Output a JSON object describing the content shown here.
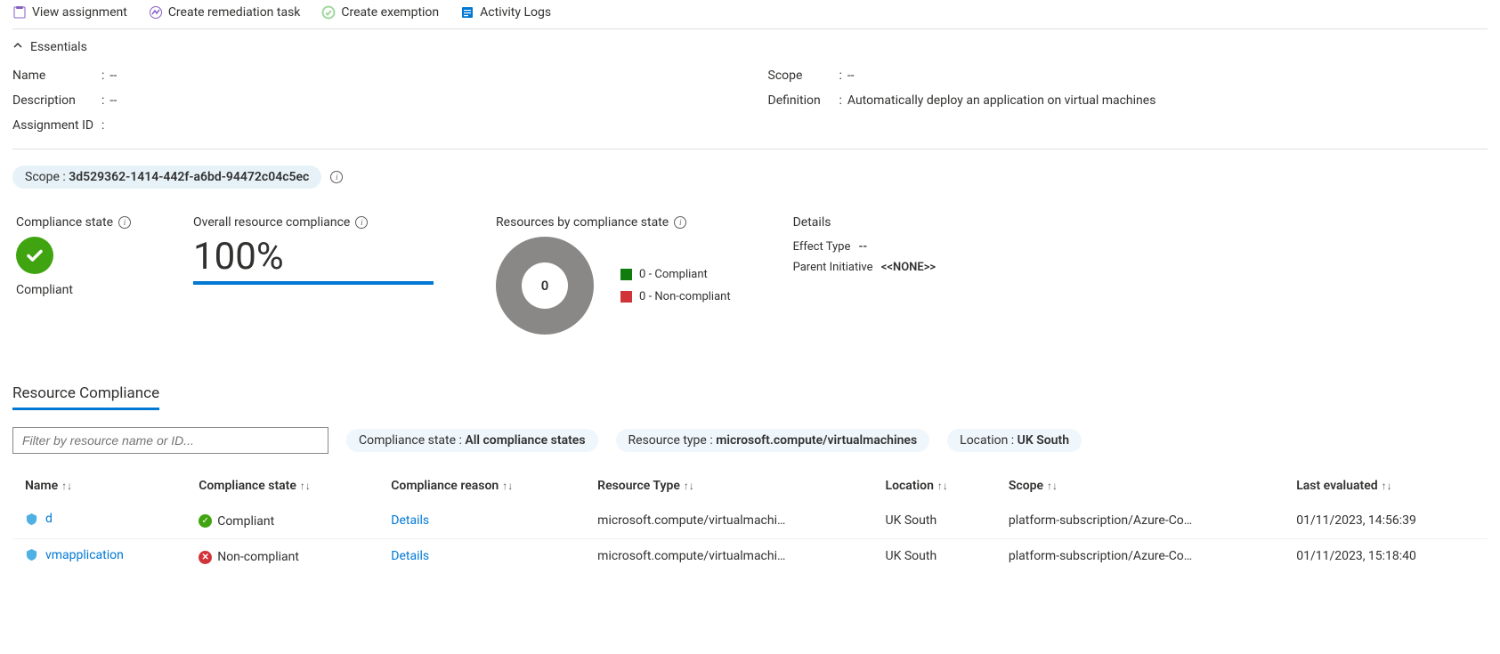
{
  "toolbar": {
    "view_assignment": "View assignment",
    "create_remediation": "Create remediation task",
    "create_exemption": "Create exemption",
    "activity_logs": "Activity Logs"
  },
  "essentials": {
    "header": "Essentials",
    "left": [
      {
        "label": "Name",
        "value": "--"
      },
      {
        "label": "Description",
        "value": "--"
      },
      {
        "label": "Assignment ID",
        "value": ""
      }
    ],
    "right": [
      {
        "label": "Scope",
        "value": "--"
      },
      {
        "label": "Definition",
        "value": "Automatically deploy an application on virtual machines"
      }
    ]
  },
  "scope_pill": {
    "label": "Scope",
    "value": "3d529362-1414-442f-a6bd-94472c04c5ec"
  },
  "tiles": {
    "compliance_state": {
      "title": "Compliance state",
      "status": "Compliant"
    },
    "overall": {
      "title": "Overall resource compliance",
      "percent": "100%"
    },
    "by_state": {
      "title": "Resources by compliance state",
      "total": "0",
      "legend": [
        {
          "text": "0 - Compliant",
          "color": "green"
        },
        {
          "text": "0 - Non-compliant",
          "color": "red"
        }
      ]
    },
    "details": {
      "title": "Details",
      "effect_type_label": "Effect Type",
      "effect_type_value": "--",
      "parent_label": "Parent Initiative",
      "parent_value": "<<NONE>>"
    }
  },
  "tabs": {
    "resource_compliance": "Resource Compliance"
  },
  "filters": {
    "placeholder": "Filter by resource name or ID...",
    "compliance_state": {
      "label": "Compliance state",
      "value": "All compliance states"
    },
    "resource_type": {
      "label": "Resource type",
      "value": "microsoft.compute/virtualmachines"
    },
    "location": {
      "label": "Location",
      "value": "UK South"
    }
  },
  "table": {
    "columns": [
      "Name",
      "Compliance state",
      "Compliance reason",
      "Resource Type",
      "Location",
      "Scope",
      "Last evaluated"
    ],
    "rows": [
      {
        "name": "d",
        "compliance": "Compliant",
        "compliance_ok": true,
        "reason": "Details",
        "resource_type": "microsoft.compute/virtualmachi…",
        "location": "UK South",
        "scope": "platform-subscription/Azure-Co…",
        "last_eval": "01/11/2023, 14:56:39"
      },
      {
        "name": "vmapplication",
        "compliance": "Non-compliant",
        "compliance_ok": false,
        "reason": "Details",
        "resource_type": "microsoft.compute/virtualmachi…",
        "location": "UK South",
        "scope": "platform-subscription/Azure-Co…",
        "last_eval": "01/11/2023, 15:18:40"
      }
    ]
  },
  "chart_data": {
    "type": "pie",
    "title": "Resources by compliance state",
    "categories": [
      "Compliant",
      "Non-compliant"
    ],
    "values": [
      0,
      0
    ],
    "total": 0
  }
}
